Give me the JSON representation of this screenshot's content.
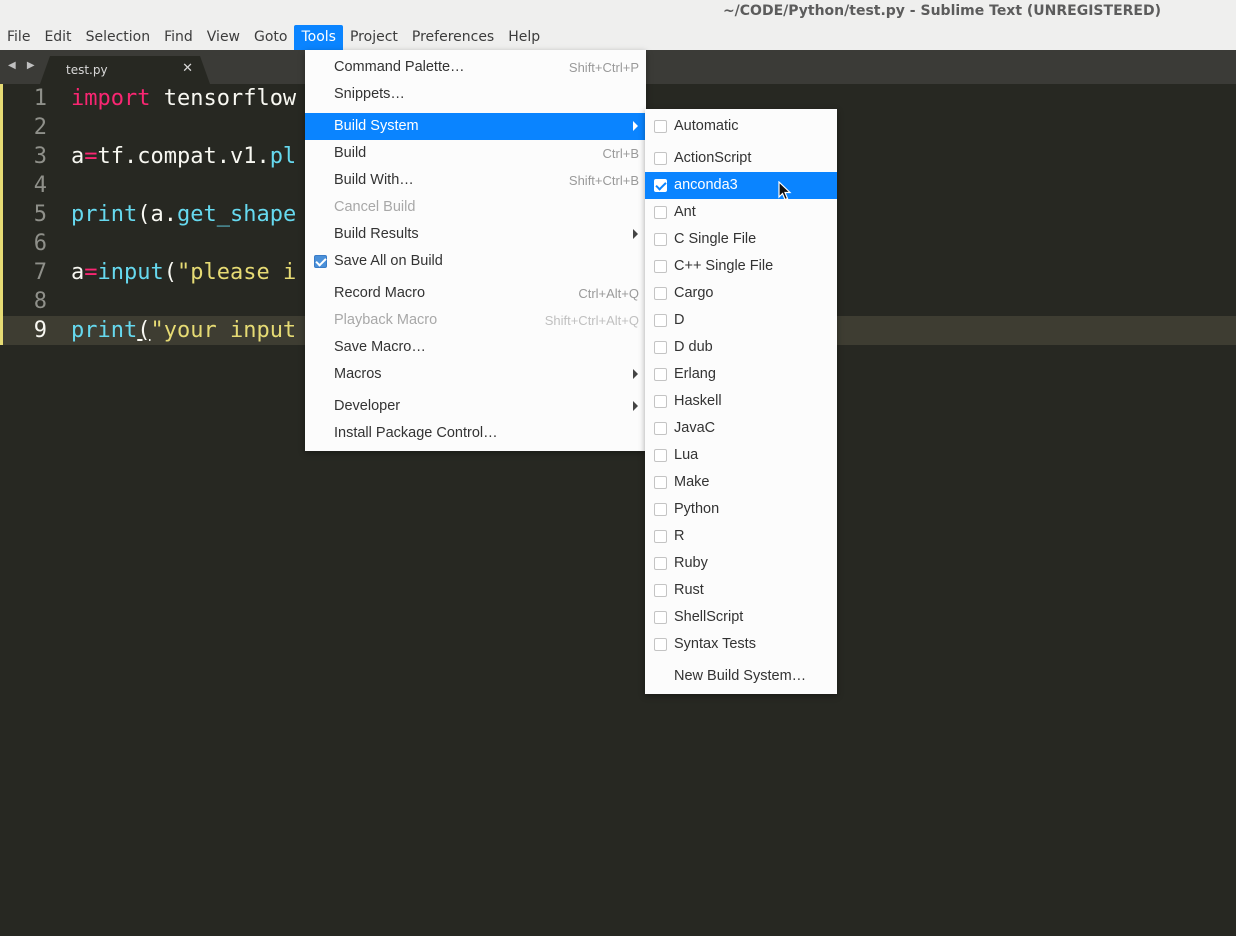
{
  "window": {
    "title": "~/CODE/Python/test.py - Sublime Text (UNREGISTERED)"
  },
  "menubar": {
    "items": [
      {
        "label": "File"
      },
      {
        "label": "Edit"
      },
      {
        "label": "Selection"
      },
      {
        "label": "Find"
      },
      {
        "label": "View"
      },
      {
        "label": "Goto"
      },
      {
        "label": "Tools"
      },
      {
        "label": "Project"
      },
      {
        "label": "Preferences"
      },
      {
        "label": "Help"
      }
    ],
    "active": "Tools"
  },
  "tabs": {
    "nav": "◀ ▶",
    "active_tab": {
      "label": "test.py",
      "close": "✕"
    }
  },
  "editor": {
    "lines": [
      {
        "num": "1"
      },
      {
        "num": "2"
      },
      {
        "num": "3"
      },
      {
        "num": "4"
      },
      {
        "num": "5"
      },
      {
        "num": "6"
      },
      {
        "num": "7"
      },
      {
        "num": "8"
      },
      {
        "num": "9"
      }
    ],
    "code": {
      "l1_kw": "import",
      "l1_rest": " tensorflow",
      "l3_a": "a",
      "l3_eq": "=",
      "l3_rest": "tf.compat.v1.",
      "l3_fn": "pl",
      "l5_fn": "print",
      "l5_a": "(a.",
      "l5_fn2": "get_shape",
      "l7_a": "a",
      "l7_eq": "=",
      "l7_fn": "input",
      "l7_p": "(",
      "l7_str": "\"please i",
      "l9_fn": "print",
      "l9_p": "(",
      "l9_str": "\"your input"
    },
    "current_line": 9
  },
  "tools_menu": {
    "items": [
      {
        "label": "Command Palette…",
        "shortcut": "Shift+Ctrl+P"
      },
      {
        "label": "Snippets…",
        "shortcut": ""
      },
      {
        "label": "Build System",
        "shortcut": ""
      },
      {
        "label": "Build",
        "shortcut": "Ctrl+B"
      },
      {
        "label": "Build With…",
        "shortcut": "Shift+Ctrl+B"
      },
      {
        "label": "Cancel Build",
        "shortcut": ""
      },
      {
        "label": "Build Results",
        "shortcut": ""
      },
      {
        "label": "Save All on Build",
        "shortcut": "",
        "checked": true
      },
      {
        "label": "Record Macro",
        "shortcut": "Ctrl+Alt+Q"
      },
      {
        "label": "Playback Macro",
        "shortcut": "Shift+Ctrl+Alt+Q"
      },
      {
        "label": "Save Macro…",
        "shortcut": ""
      },
      {
        "label": "Macros",
        "shortcut": ""
      },
      {
        "label": "Developer",
        "shortcut": ""
      },
      {
        "label": "Install Package Control…",
        "shortcut": ""
      }
    ]
  },
  "build_system_submenu": {
    "items": [
      {
        "label": "Automatic",
        "checked": false
      },
      {
        "label": "ActionScript",
        "checked": false
      },
      {
        "label": "anconda3",
        "checked": true
      },
      {
        "label": "Ant",
        "checked": false
      },
      {
        "label": "C Single File",
        "checked": false
      },
      {
        "label": "C++ Single File",
        "checked": false
      },
      {
        "label": "Cargo",
        "checked": false
      },
      {
        "label": "D",
        "checked": false
      },
      {
        "label": "D dub",
        "checked": false
      },
      {
        "label": "Erlang",
        "checked": false
      },
      {
        "label": "Haskell",
        "checked": false
      },
      {
        "label": "JavaC",
        "checked": false
      },
      {
        "label": "Lua",
        "checked": false
      },
      {
        "label": "Make",
        "checked": false
      },
      {
        "label": "Python",
        "checked": false
      },
      {
        "label": "R",
        "checked": false
      },
      {
        "label": "Ruby",
        "checked": false
      },
      {
        "label": "Rust",
        "checked": false
      },
      {
        "label": "ShellScript",
        "checked": false
      },
      {
        "label": "Syntax Tests",
        "checked": false
      },
      {
        "label": "New Build System…"
      }
    ]
  },
  "colors": {
    "accent": "#0a84ff",
    "editor_bg": "#272822",
    "keyword": "#f92672",
    "function": "#66d9ef",
    "string": "#e6db74"
  }
}
